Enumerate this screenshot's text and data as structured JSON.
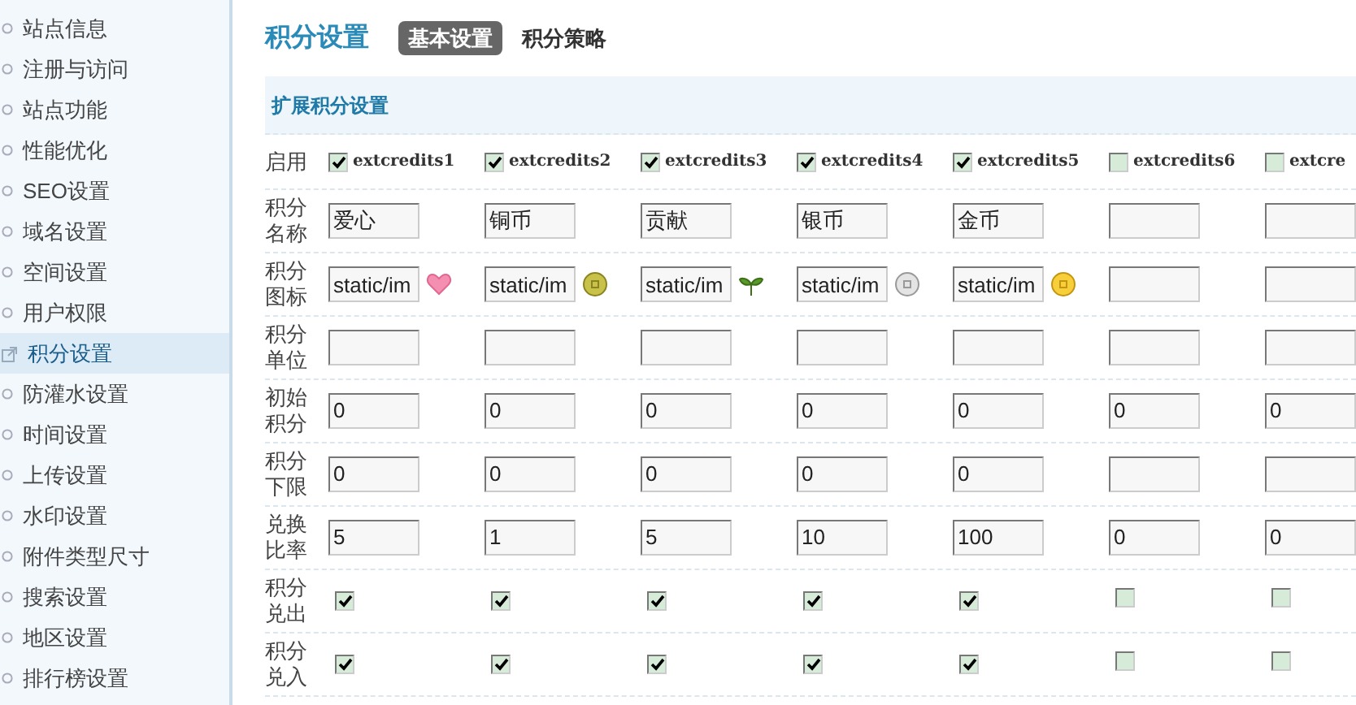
{
  "sidebar": {
    "items": [
      {
        "label": "站点信息",
        "selected": false
      },
      {
        "label": "注册与访问",
        "selected": false
      },
      {
        "label": "站点功能",
        "selected": false
      },
      {
        "label": "性能优化",
        "selected": false
      },
      {
        "label": "SEO设置",
        "selected": false
      },
      {
        "label": "域名设置",
        "selected": false
      },
      {
        "label": "空间设置",
        "selected": false
      },
      {
        "label": "用户权限",
        "selected": false
      },
      {
        "label": "积分设置",
        "selected": true
      },
      {
        "label": "防灌水设置",
        "selected": false
      },
      {
        "label": "时间设置",
        "selected": false
      },
      {
        "label": "上传设置",
        "selected": false
      },
      {
        "label": "水印设置",
        "selected": false
      },
      {
        "label": "附件类型尺寸",
        "selected": false
      },
      {
        "label": "搜索设置",
        "selected": false
      },
      {
        "label": "地区设置",
        "selected": false
      },
      {
        "label": "排行榜设置",
        "selected": false
      }
    ]
  },
  "page_title": "积分设置",
  "tabs": [
    {
      "label": "基本设置",
      "selected": true
    },
    {
      "label": "积分策略",
      "selected": false
    }
  ],
  "section_title": "扩展积分设置",
  "rows": [
    {
      "label": "启用",
      "kind": "enable"
    },
    {
      "label": "积分名称",
      "kind": "name"
    },
    {
      "label": "积分图标",
      "kind": "icon"
    },
    {
      "label": "积分单位",
      "kind": "unit"
    },
    {
      "label": "初始积分",
      "kind": "initial"
    },
    {
      "label": "积分下限",
      "kind": "lower"
    },
    {
      "label": "兑换比率",
      "kind": "ratio"
    },
    {
      "label": "积分兑出",
      "kind": "out"
    },
    {
      "label": "积分兑入",
      "kind": "in"
    }
  ],
  "columns": [
    {
      "key": "extcredits1",
      "enabled": true,
      "name": "爱心",
      "icon_path": "static/im",
      "kind": "heart",
      "initial": "0",
      "lower": "0",
      "ratio": "5",
      "out": true,
      "in": true
    },
    {
      "key": "extcredits2",
      "enabled": true,
      "name": "铜币",
      "icon_path": "static/im",
      "kind": "bronze-coin",
      "initial": "0",
      "lower": "0",
      "ratio": "1",
      "out": true,
      "in": true
    },
    {
      "key": "extcredits3",
      "enabled": true,
      "name": "贡献",
      "icon_path": "static/im",
      "kind": "sprout",
      "initial": "0",
      "lower": "0",
      "ratio": "5",
      "out": true,
      "in": true
    },
    {
      "key": "extcredits4",
      "enabled": true,
      "name": "银币",
      "icon_path": "static/im",
      "kind": "silver-coin",
      "initial": "0",
      "lower": "0",
      "ratio": "10",
      "out": true,
      "in": true
    },
    {
      "key": "extcredits5",
      "enabled": true,
      "name": "金币",
      "icon_path": "static/im",
      "kind": "gold-coin",
      "initial": "0",
      "lower": "0",
      "ratio": "100",
      "out": true,
      "in": true
    },
    {
      "key": "extcredits6",
      "enabled": false,
      "initial": "0",
      "ratio": "0",
      "out": false,
      "in": false
    },
    {
      "key": "extcre",
      "enabled": false,
      "initial": "0",
      "ratio": "0",
      "out": false,
      "in": false
    }
  ]
}
